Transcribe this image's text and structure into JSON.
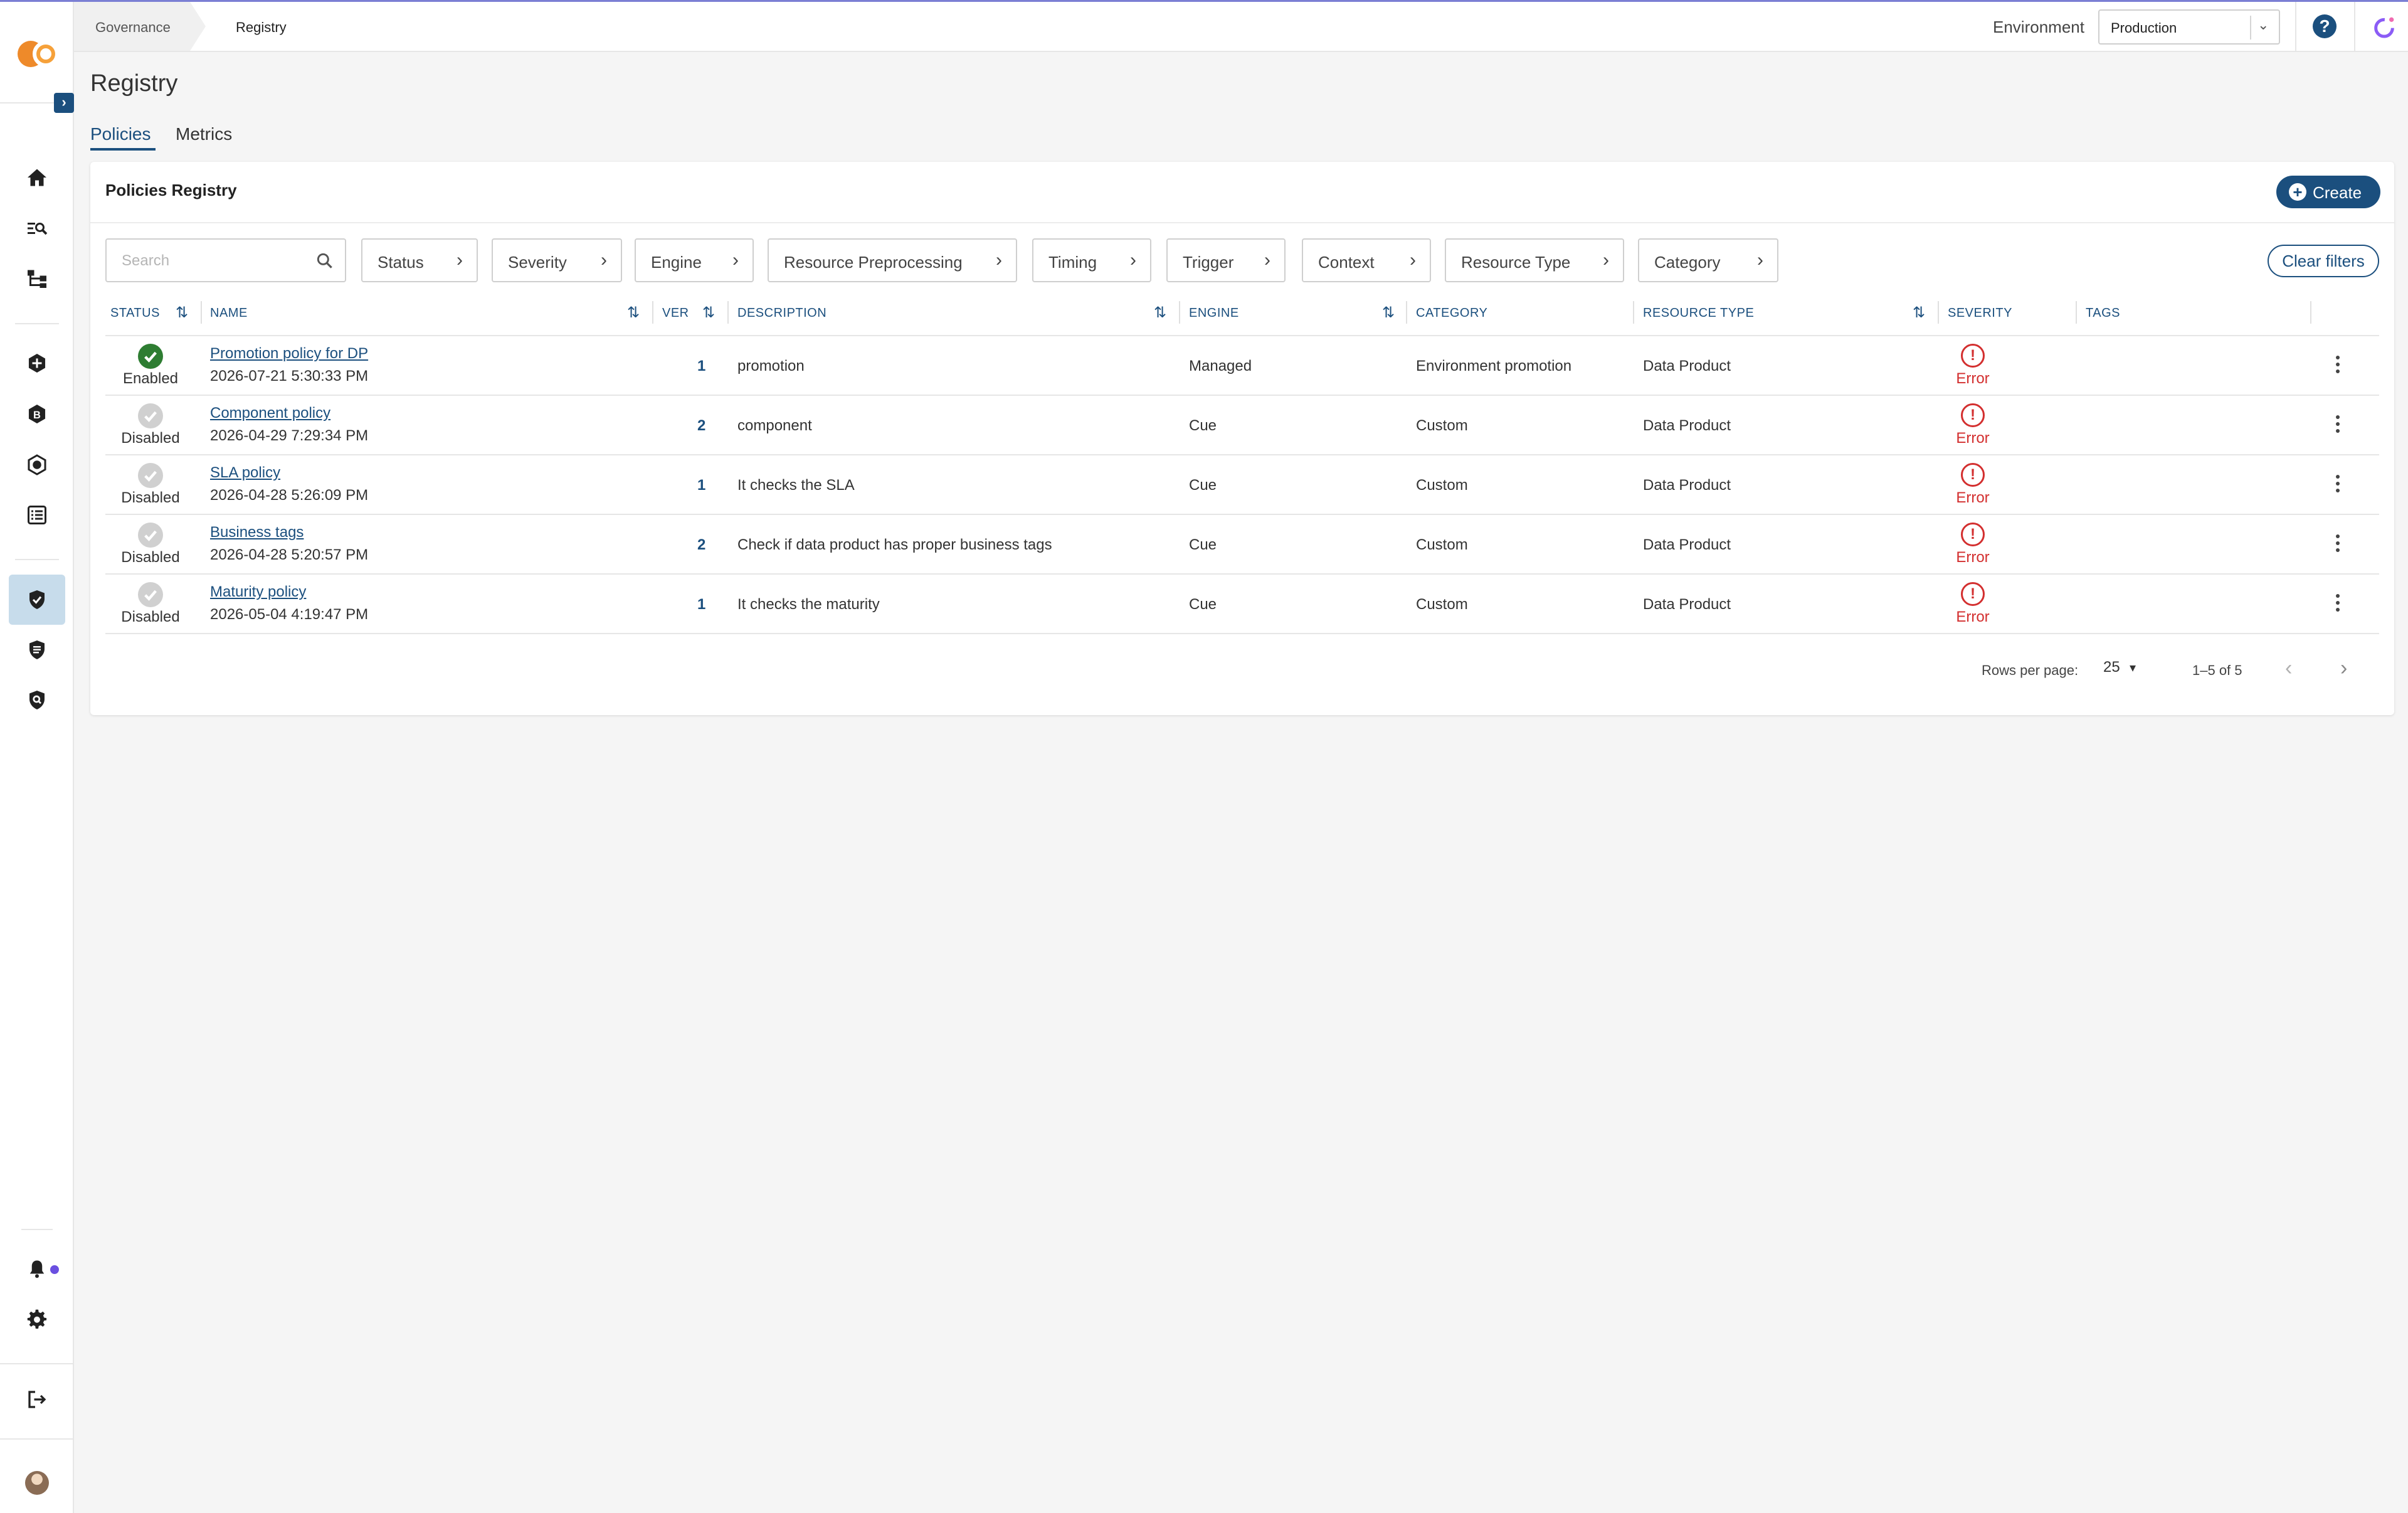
{
  "header": {
    "breadcrumbs": [
      "Governance",
      "Registry"
    ],
    "environment_label": "Environment",
    "environment_value": "Production"
  },
  "page": {
    "title": "Registry",
    "tabs": [
      {
        "label": "Policies",
        "active": true
      },
      {
        "label": "Metrics",
        "active": false
      }
    ]
  },
  "card": {
    "title": "Policies Registry",
    "create_label": "Create",
    "search_placeholder": "Search",
    "filters": [
      "Status",
      "Severity",
      "Engine",
      "Resource Preprocessing",
      "Timing",
      "Trigger",
      "Context",
      "Resource Type",
      "Category"
    ],
    "clear_filters_label": "Clear filters"
  },
  "table": {
    "columns": [
      "STATUS",
      "NAME",
      "VER",
      "DESCRIPTION",
      "ENGINE",
      "CATEGORY",
      "RESOURCE TYPE",
      "SEVERITY",
      "TAGS"
    ],
    "rows": [
      {
        "status": "Enabled",
        "name": "Promotion policy for DP",
        "date": "2026-07-21 5:30:33 PM",
        "version": "1",
        "description": "promotion",
        "engine": "Managed",
        "category": "Environment promotion",
        "resource_type": "Data Product",
        "severity": "Error"
      },
      {
        "status": "Disabled",
        "name": "Component policy",
        "date": "2026-04-29 7:29:34 PM",
        "version": "2",
        "description": "component",
        "engine": "Cue",
        "category": "Custom",
        "resource_type": "Data Product",
        "severity": "Error"
      },
      {
        "status": "Disabled",
        "name": "SLA policy",
        "date": "2026-04-28 5:26:09 PM",
        "version": "1",
        "description": "It checks the SLA",
        "engine": "Cue",
        "category": "Custom",
        "resource_type": "Data Product",
        "severity": "Error"
      },
      {
        "status": "Disabled",
        "name": "Business tags",
        "date": "2026-04-28 5:20:57 PM",
        "version": "2",
        "description": "Check if data product has proper business tags",
        "engine": "Cue",
        "category": "Custom",
        "resource_type": "Data Product",
        "severity": "Error"
      },
      {
        "status": "Disabled",
        "name": "Maturity policy",
        "date": "2026-05-04 4:19:47 PM",
        "version": "1",
        "description": "It checks the maturity",
        "engine": "Cue",
        "category": "Custom",
        "resource_type": "Data Product",
        "severity": "Error"
      }
    ]
  },
  "pagination": {
    "rows_per_page_label": "Rows per page:",
    "rows_per_page": "25",
    "range": "1–5 of 5"
  },
  "colors": {
    "primary": "#1b4f7e",
    "enabled": "#2e7d32",
    "error": "#d32f2f",
    "disabled": "#d0d0d0",
    "logo_orange": "#ee8a2a"
  },
  "icons": {
    "sidebar": [
      "home-icon",
      "search-list-icon",
      "hierarchy-icon",
      "add-circle-icon",
      "b-badge-icon",
      "target-icon",
      "list-icon",
      "shield-check-icon",
      "shield-list-icon",
      "shield-search-icon",
      "bell-icon",
      "gear-icon",
      "logout-icon"
    ]
  }
}
